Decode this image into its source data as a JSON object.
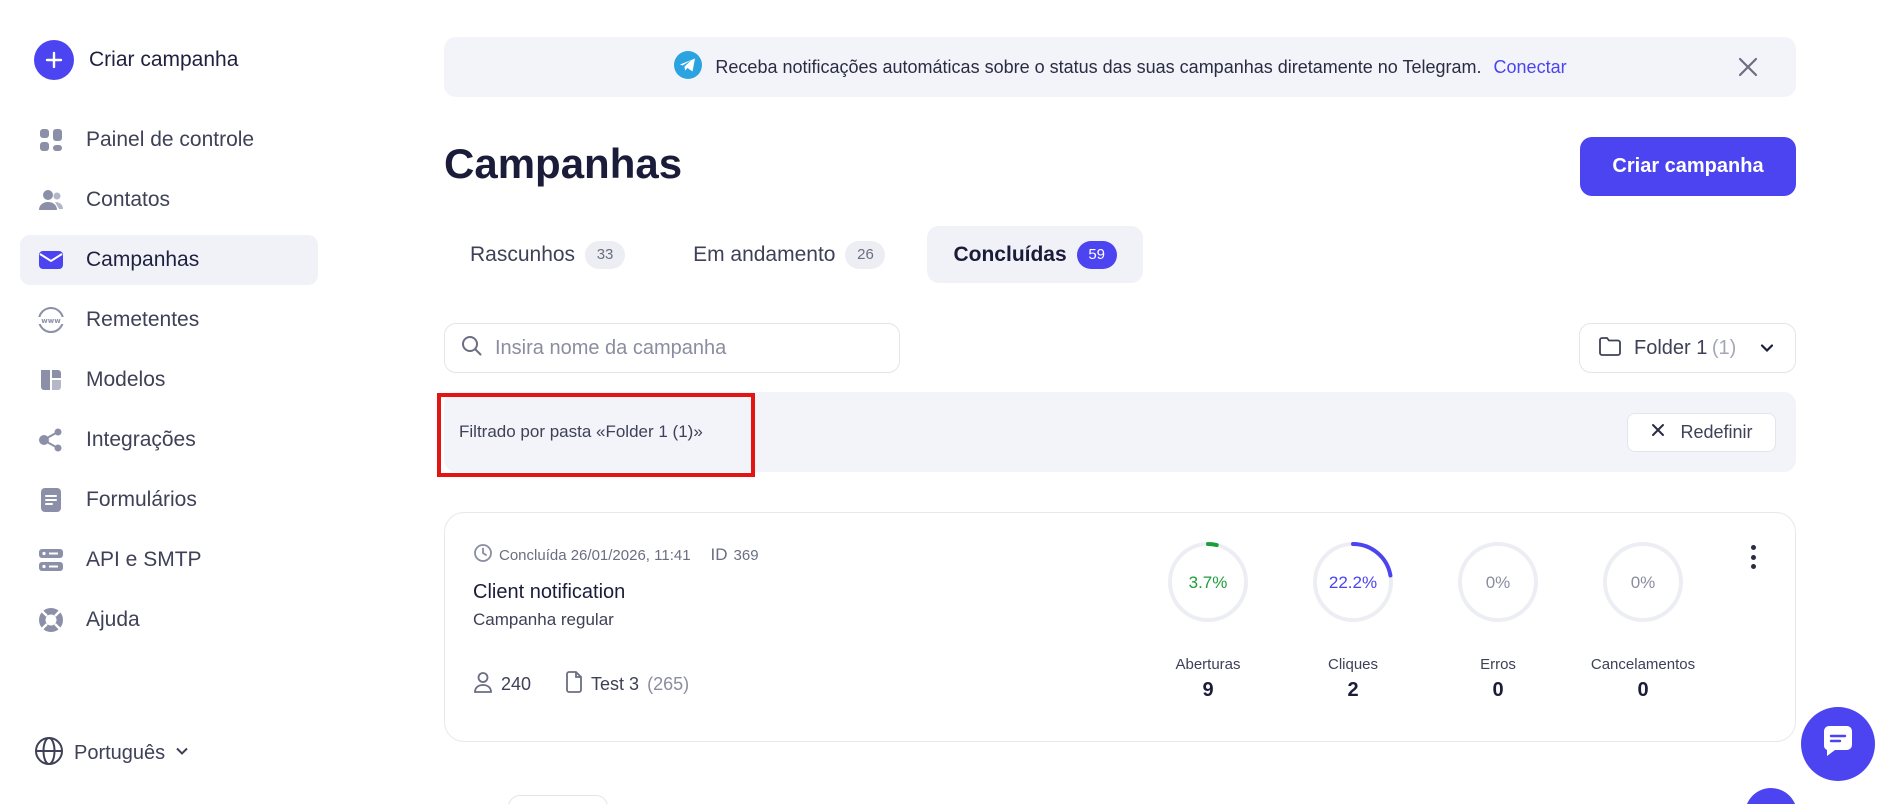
{
  "sidebar": {
    "create_label": "Criar campanha",
    "items": [
      {
        "label": "Painel de controle",
        "icon": "dashboard-icon",
        "active": false
      },
      {
        "label": "Contatos",
        "icon": "contacts-icon",
        "active": false
      },
      {
        "label": "Campanhas",
        "icon": "campaigns-icon",
        "active": true
      },
      {
        "label": "Remetentes",
        "icon": "senders-icon",
        "active": false
      },
      {
        "label": "Modelos",
        "icon": "templates-icon",
        "active": false
      },
      {
        "label": "Integrações",
        "icon": "integrations-icon",
        "active": false
      },
      {
        "label": "Formulários",
        "icon": "forms-icon",
        "active": false
      },
      {
        "label": "API e SMTP",
        "icon": "api-icon",
        "active": false
      },
      {
        "label": "Ajuda",
        "icon": "help-icon",
        "active": false
      }
    ],
    "language": "Português"
  },
  "banner": {
    "text": "Receba notificações automáticas sobre o status das suas campanhas diretamente no Telegram.",
    "link": "Conectar"
  },
  "page": {
    "title": "Campanhas",
    "create_button": "Criar campanha"
  },
  "tabs": [
    {
      "label": "Rascunhos",
      "count": "33",
      "active": false
    },
    {
      "label": "Em andamento",
      "count": "26",
      "active": false
    },
    {
      "label": "Concluídas",
      "count": "59",
      "active": true
    }
  ],
  "search": {
    "placeholder": "Insira nome da campanha"
  },
  "folder": {
    "name": "Folder 1",
    "count": "(1)"
  },
  "filter": {
    "text": "Filtrado por pasta «Folder 1 (1)»",
    "reset_label": "Redefinir"
  },
  "campaign": {
    "status": "Concluída 26/01/2026, 11:41",
    "id_label": "ID",
    "id_value": "369",
    "title": "Client notification",
    "type": "Campanha regular",
    "recipients": "240",
    "list_name": "Test 3",
    "list_count": "(265)",
    "stats": [
      {
        "label": "Aberturas",
        "percent_text": "3.7%",
        "percent": 3.7,
        "value": "9",
        "color": "#1f9d3a"
      },
      {
        "label": "Cliques",
        "percent_text": "22.2%",
        "percent": 22.2,
        "value": "2",
        "color": "#4b44f0"
      },
      {
        "label": "Erros",
        "percent_text": "0%",
        "percent": 0,
        "value": "0",
        "color": "#8a8da0"
      },
      {
        "label": "Cancelamentos",
        "percent_text": "0%",
        "percent": 0,
        "value": "0",
        "color": "#8a8da0"
      }
    ]
  },
  "colors": {
    "accent": "#4b44f0",
    "highlight": "#e31414",
    "surface": "#f2f4f9"
  }
}
